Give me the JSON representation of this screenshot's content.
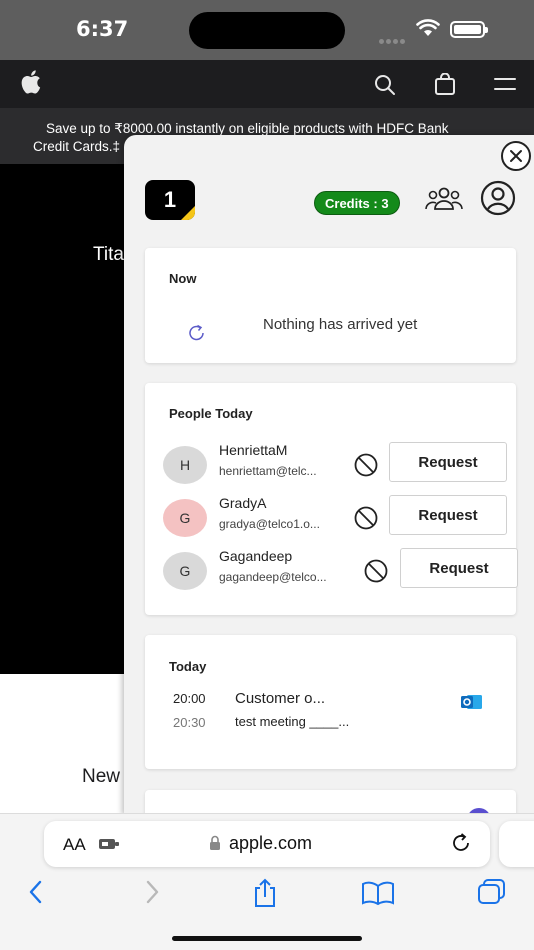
{
  "status_bar": {
    "time": "6:37"
  },
  "promo": {
    "line1": "Save up to ₹8000.00 instantly on eligible products with HDFC Bank",
    "line2": "Credit Cards.",
    "line2_suffix": "‡"
  },
  "background": {
    "title_fragment": "Tita",
    "new_fragment": "New"
  },
  "panel": {
    "logo_text": "1",
    "credits_label": "Credits : 3",
    "now": {
      "title": "Now",
      "empty_message": "Nothing has arrived yet"
    },
    "people_today": {
      "title": "People Today",
      "request_label": "Request",
      "people": [
        {
          "initial": "H",
          "name": "HenriettaM",
          "email": "henriettam@telc...",
          "avatar_color": "#d9d9d9"
        },
        {
          "initial": "G",
          "name": "GradyA",
          "email": "gradya@telco1.o...",
          "avatar_color": "#f4c2c2"
        },
        {
          "initial": "G",
          "name": "Gagandeep",
          "email": "gagandeep@telco...",
          "avatar_color": "#d9d9d9"
        }
      ]
    },
    "today": {
      "title": "Today",
      "start_time": "20:00",
      "end_time": "20:30",
      "event_title": "Customer o...",
      "event_subtitle": "test meeting ____..."
    }
  },
  "safari": {
    "text_size_label": "AA",
    "url": "apple.com"
  },
  "colors": {
    "credits_green": "#148a1a",
    "safari_blue": "#1a73e8",
    "outlook_blue": "#0f6cbd"
  }
}
